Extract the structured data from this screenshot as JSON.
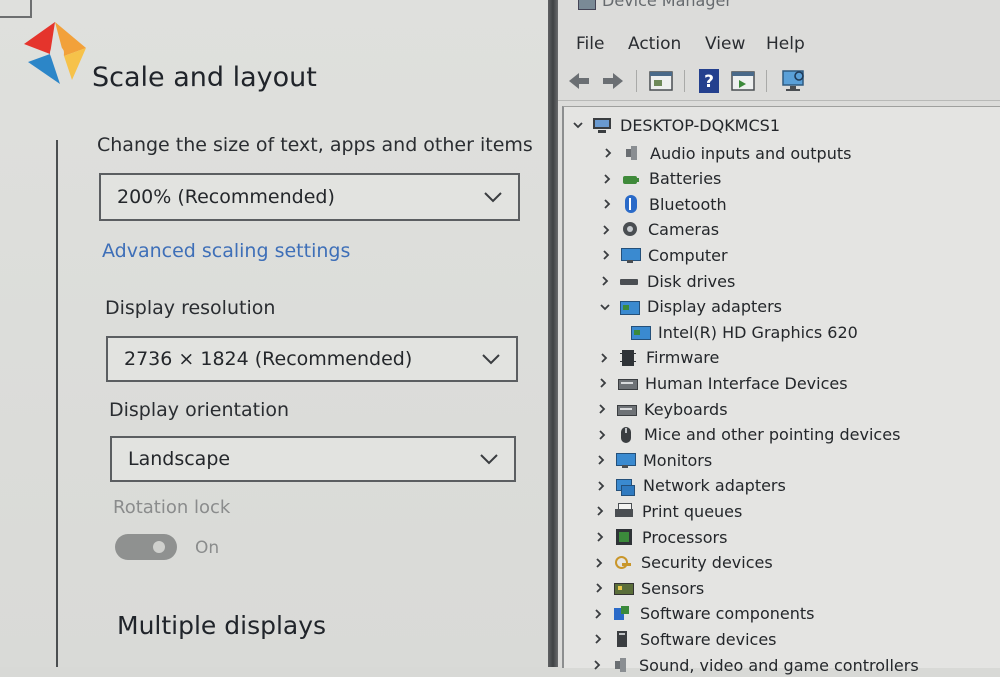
{
  "settings": {
    "title": "Scale and layout",
    "scale": {
      "label": "Change the size of text, apps and other items",
      "value": "200% (Recommended)"
    },
    "advanced_link": "Advanced scaling settings",
    "resolution": {
      "label": "Display resolution",
      "value": "2736 × 1824 (Recommended)"
    },
    "orientation": {
      "label": "Display orientation",
      "value": "Landscape"
    },
    "rotation_lock": {
      "label": "Rotation lock",
      "state": "On"
    },
    "multiple_displays_heading": "Multiple displays"
  },
  "device_manager": {
    "title": "Device Manager",
    "menu": [
      "File",
      "Action",
      "View",
      "Help"
    ],
    "toolbar_icons": [
      "back-arrow-icon",
      "forward-arrow-icon",
      "properties-icon",
      "help-icon",
      "update-driver-icon",
      "scan-hardware-icon"
    ],
    "root": "DESKTOP-DQKMCS1",
    "nodes": [
      {
        "label": "Audio inputs and outputs",
        "icon": "speaker-icon",
        "expanded": false
      },
      {
        "label": "Batteries",
        "icon": "battery-icon",
        "expanded": false
      },
      {
        "label": "Bluetooth",
        "icon": "bluetooth-icon",
        "expanded": false
      },
      {
        "label": "Cameras",
        "icon": "camera-icon",
        "expanded": false
      },
      {
        "label": "Computer",
        "icon": "monitor-icon",
        "expanded": false
      },
      {
        "label": "Disk drives",
        "icon": "disk-drive-icon",
        "expanded": false
      },
      {
        "label": "Display adapters",
        "icon": "display-adapter-icon",
        "expanded": true
      },
      {
        "label": "Intel(R) HD Graphics 620",
        "icon": "display-adapter-icon",
        "child": true
      },
      {
        "label": "Firmware",
        "icon": "chip-icon",
        "expanded": false
      },
      {
        "label": "Human Interface Devices",
        "icon": "keyboard-icon",
        "expanded": false
      },
      {
        "label": "Keyboards",
        "icon": "keyboard-icon",
        "expanded": false
      },
      {
        "label": "Mice and other pointing devices",
        "icon": "mouse-icon",
        "expanded": false
      },
      {
        "label": "Monitors",
        "icon": "monitor-icon",
        "expanded": false
      },
      {
        "label": "Network adapters",
        "icon": "network-icon",
        "expanded": false
      },
      {
        "label": "Print queues",
        "icon": "printer-icon",
        "expanded": false
      },
      {
        "label": "Processors",
        "icon": "processor-icon",
        "expanded": false
      },
      {
        "label": "Security devices",
        "icon": "key-icon",
        "expanded": false
      },
      {
        "label": "Sensors",
        "icon": "sensor-icon",
        "expanded": false
      },
      {
        "label": "Software components",
        "icon": "software-component-icon",
        "expanded": false
      },
      {
        "label": "Software devices",
        "icon": "software-device-icon",
        "expanded": false
      },
      {
        "label": "Sound, video and game controllers",
        "icon": "speaker-icon",
        "expanded": false
      }
    ]
  },
  "colors": {
    "link": "#3e6fb8",
    "toggle_on": "#8f9190"
  }
}
